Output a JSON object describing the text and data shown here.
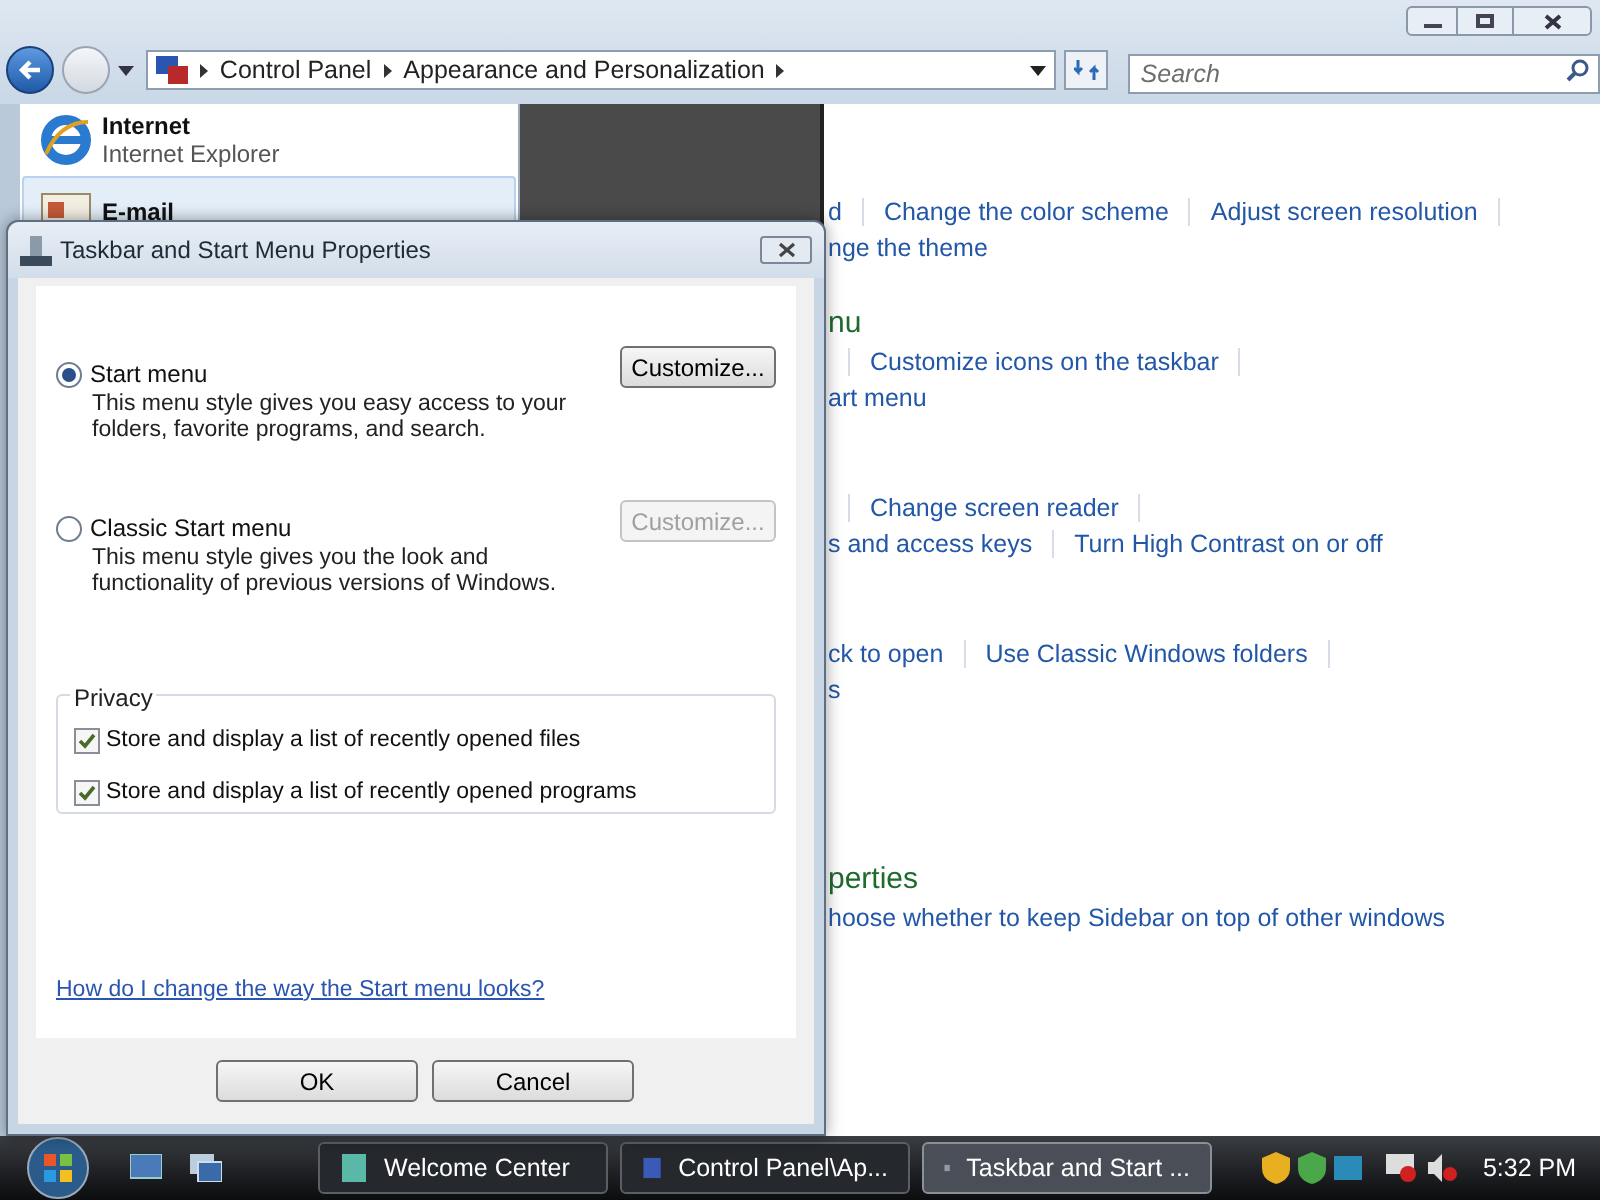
{
  "window": {
    "breadcrumbs": [
      "Control Panel",
      "Appearance and Personalization"
    ],
    "search": {
      "placeholder": "Search"
    }
  },
  "start_menu": {
    "items": [
      {
        "title": "Internet",
        "subtitle": "Internet Explorer",
        "selected": false
      },
      {
        "title": "E-mail",
        "selected": true
      }
    ]
  },
  "content": {
    "sections": [
      {
        "rows": [
          [
            {
              "kind": "fragment",
              "text": "d"
            },
            {
              "kind": "link",
              "text": "Change the color scheme"
            },
            {
              "kind": "link",
              "text": "Adjust screen resolution"
            }
          ],
          [
            {
              "kind": "fragment",
              "text": "nge the theme"
            }
          ]
        ]
      },
      {
        "heading": "nu",
        "rows": [
          [
            {
              "kind": "link",
              "text": "Customize icons on the taskbar"
            }
          ],
          [
            {
              "kind": "fragment",
              "text": "art menu"
            }
          ]
        ]
      },
      {
        "rows": [
          [
            {
              "kind": "link",
              "text": "Change screen reader"
            }
          ],
          [
            {
              "kind": "fragment",
              "text": "s and access keys"
            },
            {
              "kind": "link",
              "text": "Turn High Contrast on or off"
            }
          ]
        ]
      },
      {
        "rows": [
          [
            {
              "kind": "fragment",
              "text": "ck to open"
            },
            {
              "kind": "link",
              "text": "Use Classic Windows folders"
            }
          ],
          [
            {
              "kind": "fragment",
              "text": "s"
            }
          ]
        ]
      },
      {
        "heading": "perties",
        "rows": [
          [
            {
              "kind": "fragment",
              "text": "hoose whether to keep Sidebar on top of other windows"
            }
          ]
        ]
      }
    ]
  },
  "dialog": {
    "title": "Taskbar and Start Menu Properties",
    "options": [
      {
        "label": "Start menu",
        "lines": [
          "This menu style gives you easy access to your",
          "folders, favorite programs, and search."
        ],
        "selected": true,
        "button": {
          "label": "Customize...",
          "disabled": false
        }
      },
      {
        "label": "Classic Start menu",
        "lines": [
          "This menu style gives you the look and",
          "functionality of previous versions of Windows."
        ],
        "selected": false,
        "button": {
          "label": "Customize...",
          "disabled": true
        }
      }
    ],
    "privacy": {
      "title": "Privacy",
      "items": [
        {
          "label": "Store and display a list of recently opened files",
          "checked": true
        },
        {
          "label": "Store and display a list of recently opened programs",
          "checked": true
        }
      ]
    },
    "help_link": "How do I change the way the Start menu looks?",
    "buttons": [
      "OK",
      "Cancel"
    ]
  },
  "taskbar": {
    "tasks": [
      {
        "label": "Welcome Center",
        "selected": false
      },
      {
        "label": "Control Panel\\Ap...",
        "selected": false
      },
      {
        "label": "Taskbar and Start ...",
        "selected": true
      }
    ],
    "clock": "5:32 PM"
  }
}
